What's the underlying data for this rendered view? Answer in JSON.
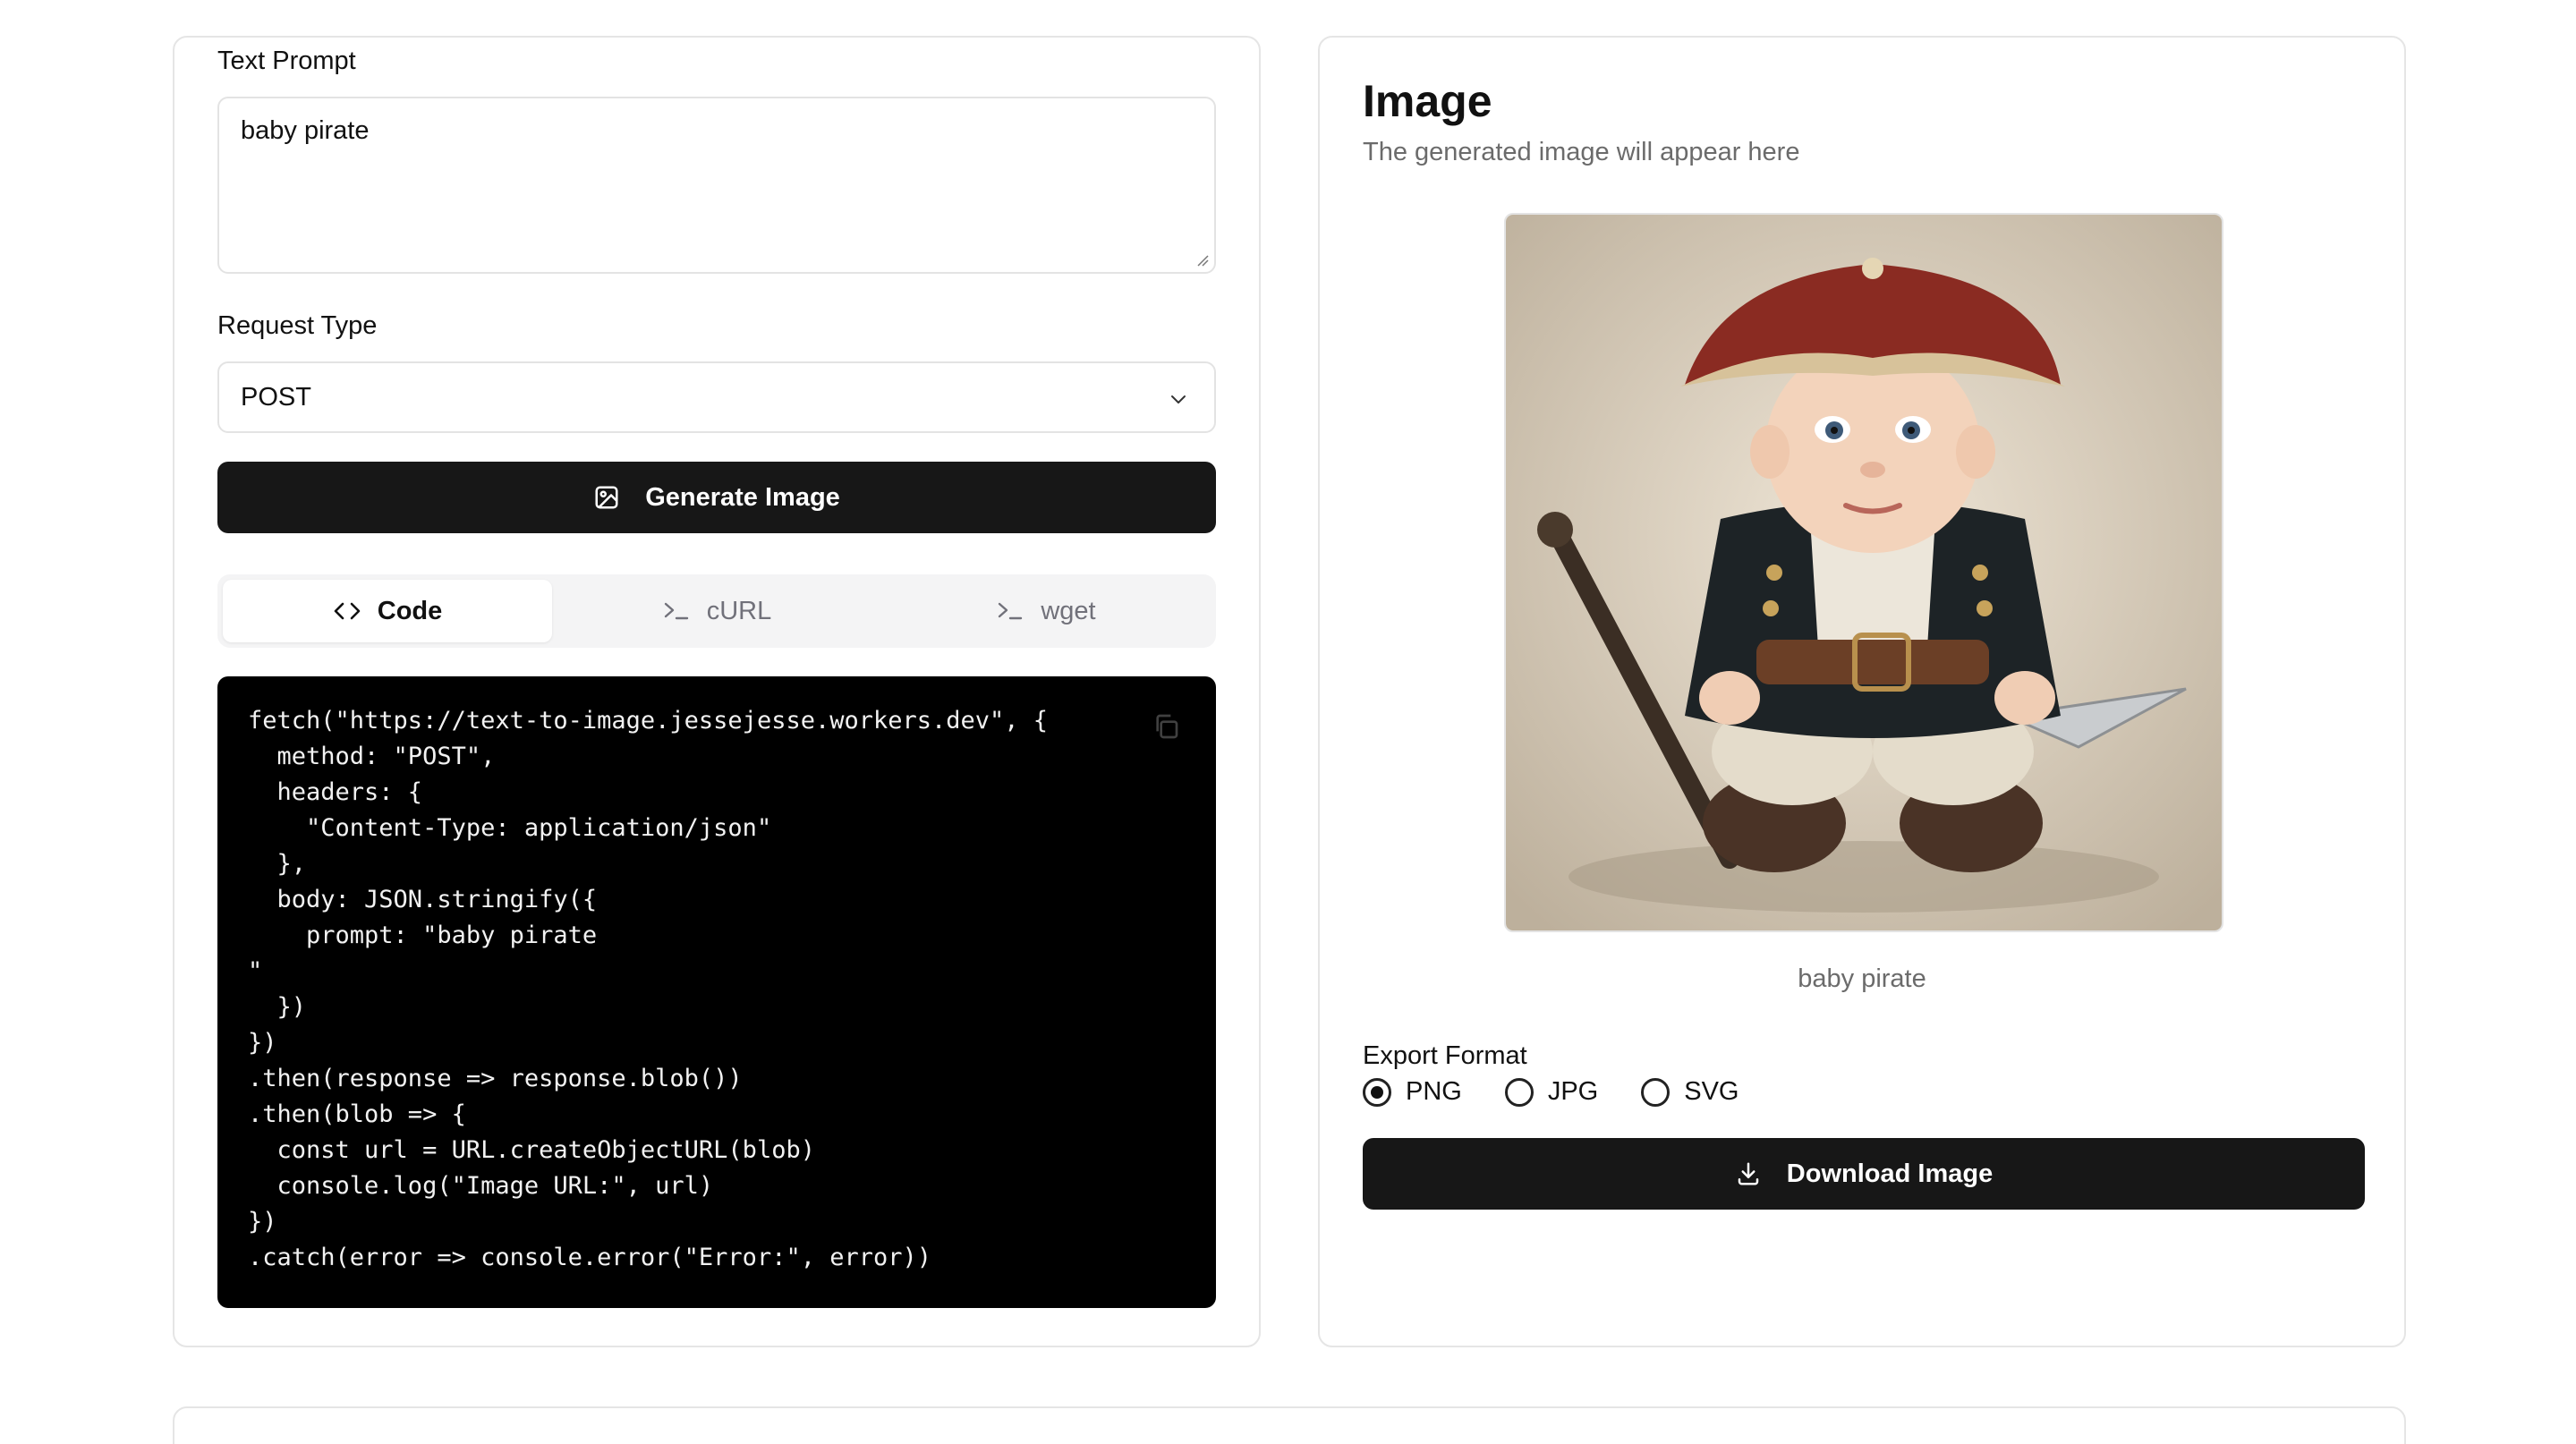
{
  "prompt_section": {
    "label": "Text Prompt",
    "value": "baby pirate"
  },
  "request_section": {
    "label": "Request Type",
    "selected": "POST"
  },
  "generate_button": {
    "label": "Generate Image"
  },
  "tabs": [
    {
      "label": "Code",
      "icon": "code-icon",
      "active": true
    },
    {
      "label": "cURL",
      "icon": "terminal-icon",
      "active": false
    },
    {
      "label": "wget",
      "icon": "terminal-icon",
      "active": false
    }
  ],
  "code_snippet": "fetch(\"https://text-to-image.jessejesse.workers.dev\", {\n  method: \"POST\",\n  headers: {\n    \"Content-Type: application/json\"\n  },\n  body: JSON.stringify({\n    prompt: \"baby pirate\n\"\n  })\n})\n.then(response => response.blob())\n.then(blob => {\n  const url = URL.createObjectURL(blob)\n  console.log(\"Image URL:\", url)\n})\n.catch(error => console.error(\"Error:\", error))",
  "image_panel": {
    "title": "Image",
    "subtitle": "The generated image will appear here",
    "caption": "baby pirate"
  },
  "export": {
    "label": "Export Format",
    "options": [
      {
        "label": "PNG",
        "checked": true
      },
      {
        "label": "JPG",
        "checked": false
      },
      {
        "label": "SVG",
        "checked": false
      }
    ]
  },
  "download_button": {
    "label": "Download Image"
  },
  "colors": {
    "primary_button": "#171717",
    "code_background": "#000000",
    "border": "#e5e5e5",
    "muted_text": "#6b6b6b"
  }
}
